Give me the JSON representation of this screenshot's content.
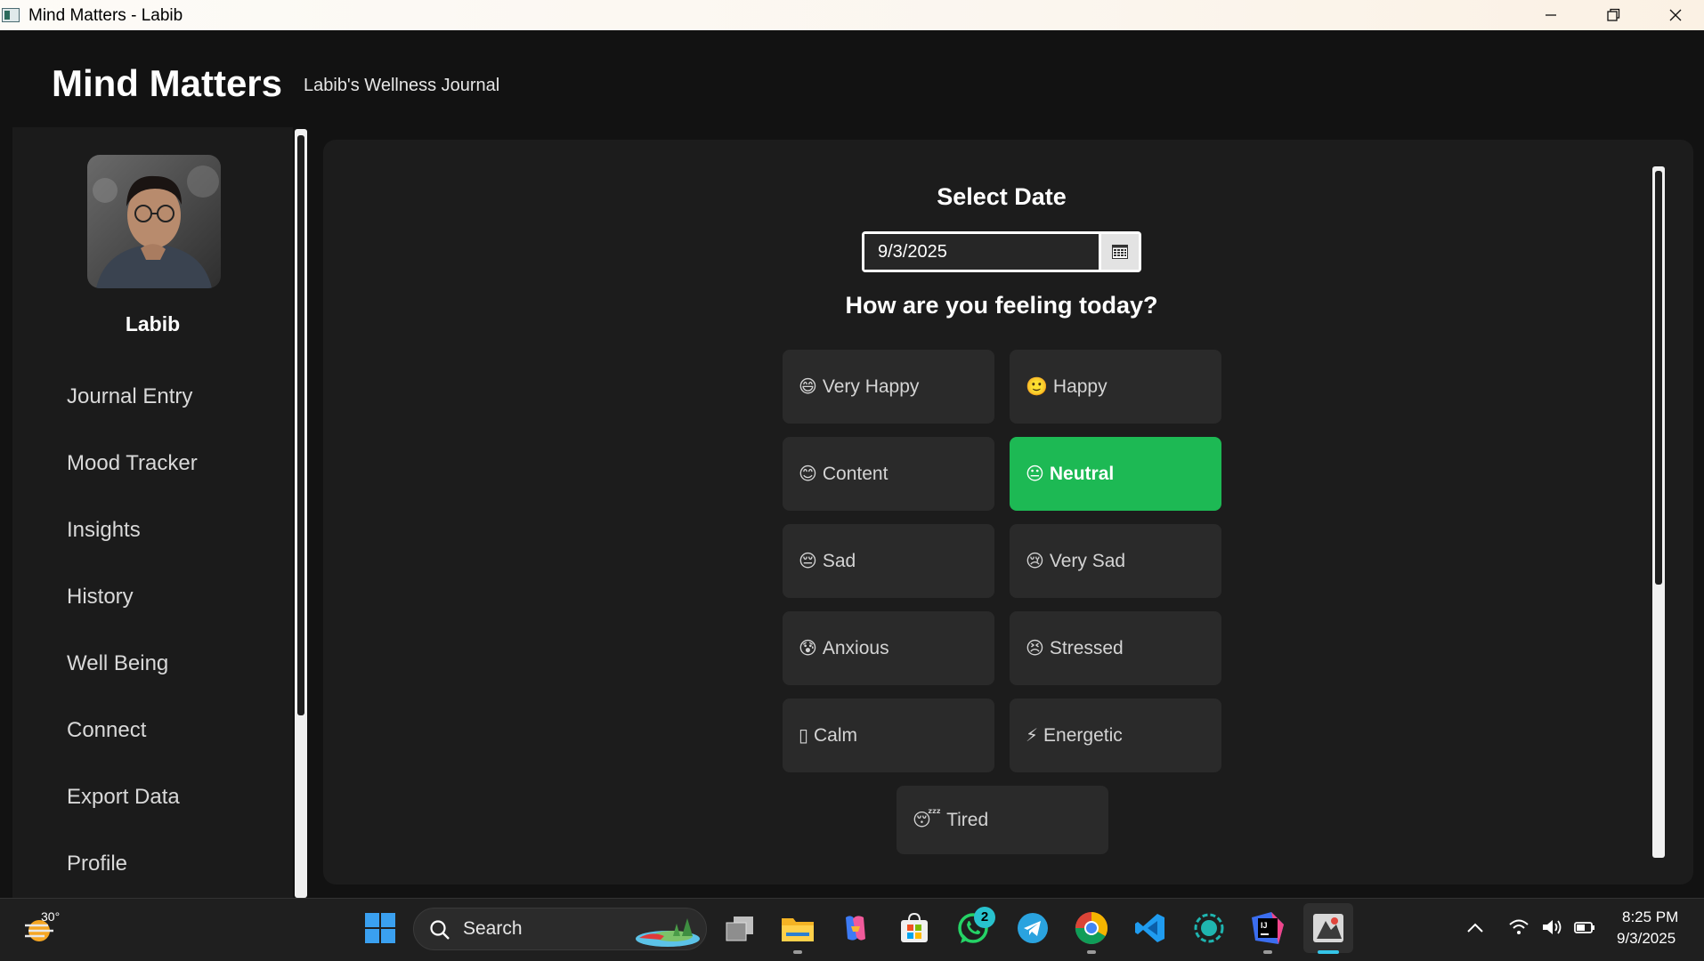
{
  "window": {
    "title": "Mind Matters - Labib",
    "minimize_icon": "minimize-icon",
    "restore_icon": "restore-icon",
    "close_icon": "close-icon"
  },
  "header": {
    "title": "Mind Matters",
    "subtitle": "Labib's Wellness Journal"
  },
  "sidebar": {
    "username": "Labib",
    "items": [
      {
        "label": "Journal Entry"
      },
      {
        "label": "Mood Tracker"
      },
      {
        "label": "Insights"
      },
      {
        "label": "History"
      },
      {
        "label": "Well Being"
      },
      {
        "label": "Connect"
      },
      {
        "label": "Export Data"
      },
      {
        "label": "Profile"
      }
    ]
  },
  "main": {
    "date_heading": "Select Date",
    "date_value": "9/3/2025",
    "question": "How are you feeling today?",
    "selected_mood": "Neutral",
    "accent_color": "#1db954",
    "moods": [
      {
        "label": "Very Happy",
        "emoji": "😄"
      },
      {
        "label": "Happy",
        "emoji": "🙂"
      },
      {
        "label": "Content",
        "emoji": "😊"
      },
      {
        "label": "Neutral",
        "emoji": "😐"
      },
      {
        "label": "Sad",
        "emoji": "😔"
      },
      {
        "label": "Very Sad",
        "emoji": "😢"
      },
      {
        "label": "Anxious",
        "emoji": "😰"
      },
      {
        "label": "Stressed",
        "emoji": "😣"
      },
      {
        "label": "Calm",
        "emoji": "▯"
      },
      {
        "label": "Energetic",
        "emoji": "⚡"
      },
      {
        "label": "Tired",
        "emoji": "😴"
      }
    ]
  },
  "taskbar": {
    "weather_temp": "30°",
    "search_label": "Search",
    "whatsapp_badge": "2",
    "time": "8:25 PM",
    "date": "9/3/2025"
  }
}
